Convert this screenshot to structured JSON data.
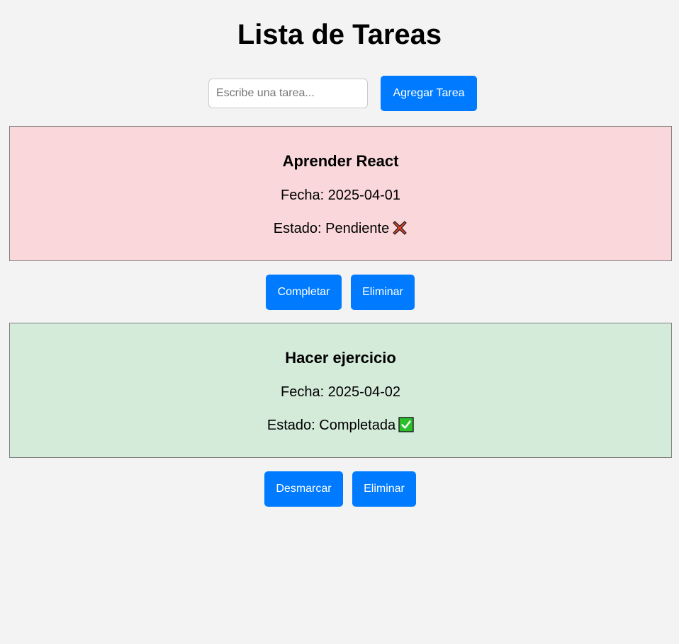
{
  "header": {
    "title": "Lista de Tareas"
  },
  "form": {
    "placeholder": "Escribe una tarea...",
    "value": "",
    "add_button": "Agregar Tarea"
  },
  "tasks": [
    {
      "name": "Aprender React",
      "date_text": "Fecha: 2025-04-01",
      "status_text": "Estado: Pendiente",
      "status_icon": "cross-mark-icon",
      "background": "#f9d7da",
      "toggle_label": "Completar",
      "delete_label": "Eliminar"
    },
    {
      "name": "Hacer ejercicio",
      "date_text": "Fecha: 2025-04-02",
      "status_text": "Estado: Completada",
      "status_icon": "check-mark-icon",
      "background": "#d4ebda",
      "toggle_label": "Desmarcar",
      "delete_label": "Eliminar"
    }
  ],
  "colors": {
    "page_background": "#f3f3f3",
    "button_primary": "#007bff",
    "button_text": "#ffffff",
    "cross_icon": "#e0442e",
    "check_icon": "#2bbf2b"
  }
}
